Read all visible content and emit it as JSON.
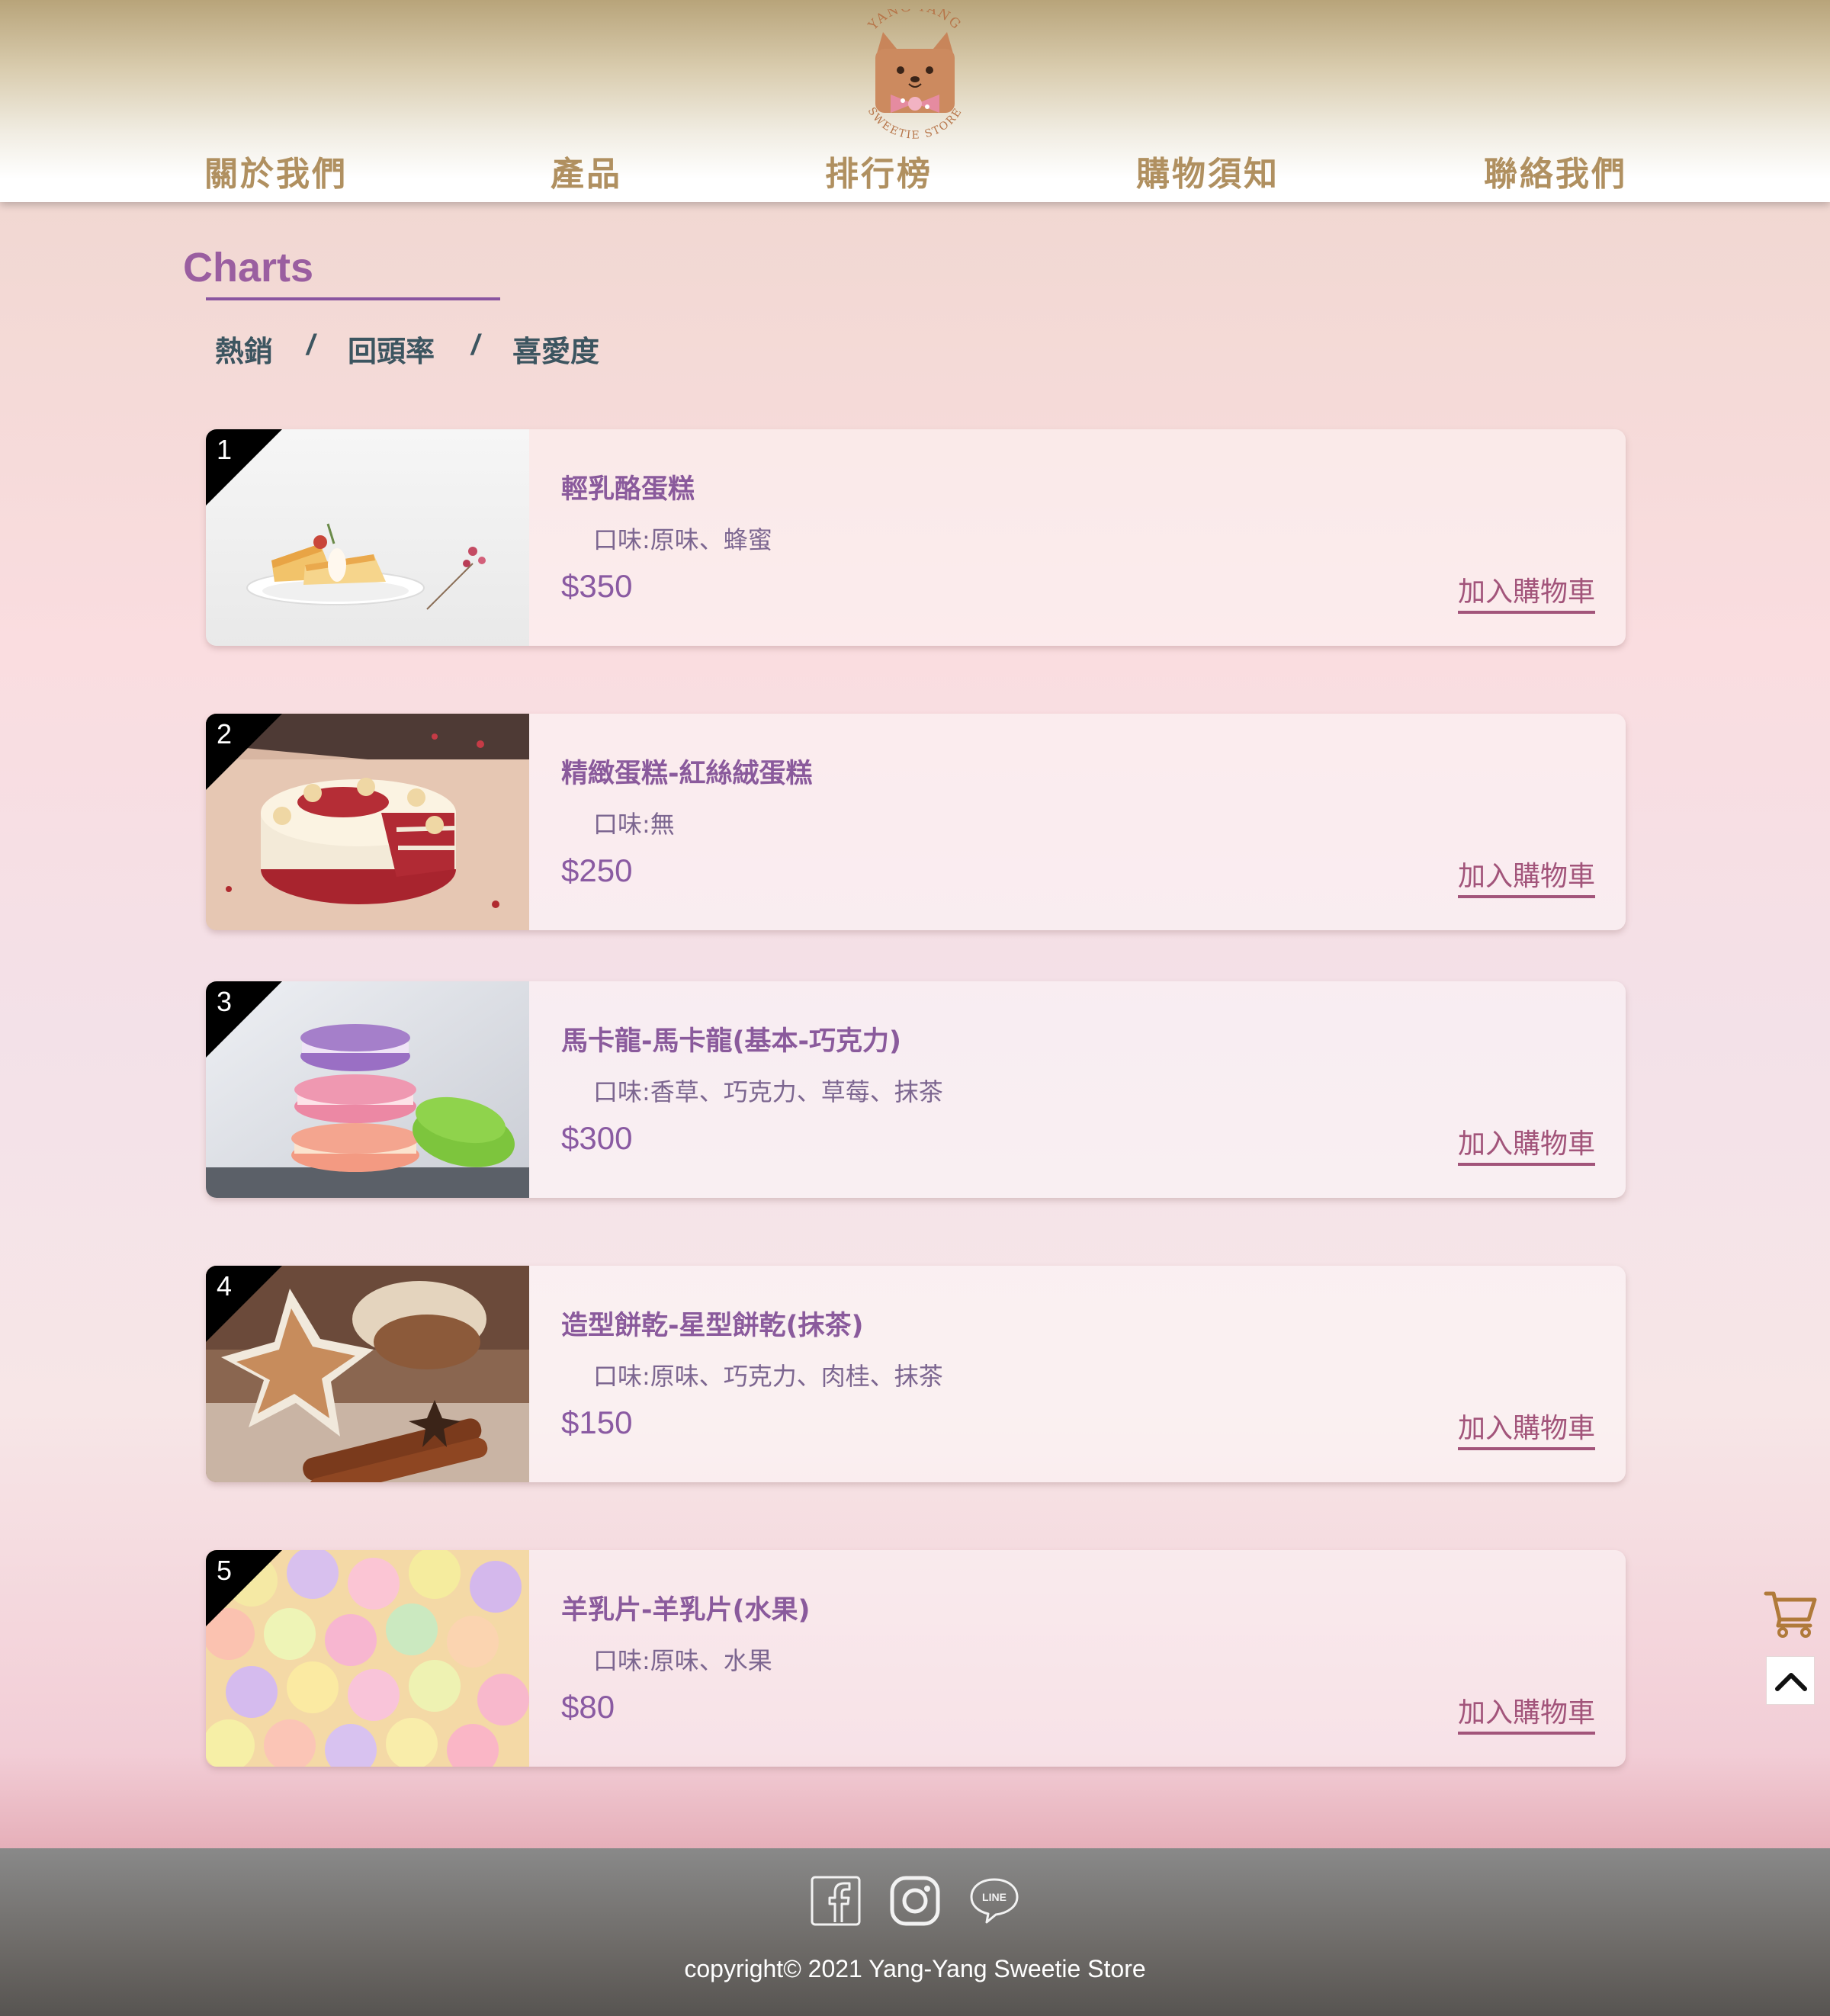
{
  "header": {
    "logo": {
      "top_text": "YANG-YANG",
      "bottom_text": "SWEETIE STORE"
    },
    "nav": [
      "關於我們",
      "產品",
      "排行榜",
      "購物須知",
      "聯絡我們"
    ]
  },
  "main": {
    "title": "Charts",
    "filters": [
      "熱銷",
      "回頭率",
      "喜愛度"
    ],
    "separator": "/",
    "add_cart_label": "加入購物車",
    "products": [
      {
        "rank": "1",
        "name": "輕乳酪蛋糕",
        "flavor": "口味:原味、蜂蜜",
        "price": "$350"
      },
      {
        "rank": "2",
        "name": "精緻蛋糕-紅絲絨蛋糕",
        "flavor": "口味:無",
        "price": "$250"
      },
      {
        "rank": "3",
        "name": "馬卡龍-馬卡龍(基本-巧克力)",
        "flavor": "口味:香草、巧克力、草莓、抹茶",
        "price": "$300"
      },
      {
        "rank": "4",
        "name": "造型餅乾-星型餅乾(抹茶)",
        "flavor": "口味:原味、巧克力、肉桂、抹茶",
        "price": "$150"
      },
      {
        "rank": "5",
        "name": "羊乳片-羊乳片(水果)",
        "flavor": "口味:原味、水果",
        "price": "$80"
      }
    ]
  },
  "footer": {
    "social": [
      "facebook-icon",
      "instagram-icon",
      "line-icon"
    ],
    "line_label": "LINE",
    "copyright": "copyright© 2021 Yang-Yang Sweetie Store"
  },
  "colors": {
    "nav_text": "#b09060",
    "title_purple": "#9a5ea0",
    "filter_text": "#3c5560",
    "product_name": "#8a5a9c",
    "add_cart": "#a2547a",
    "cart_icon": "#b07a3a"
  }
}
